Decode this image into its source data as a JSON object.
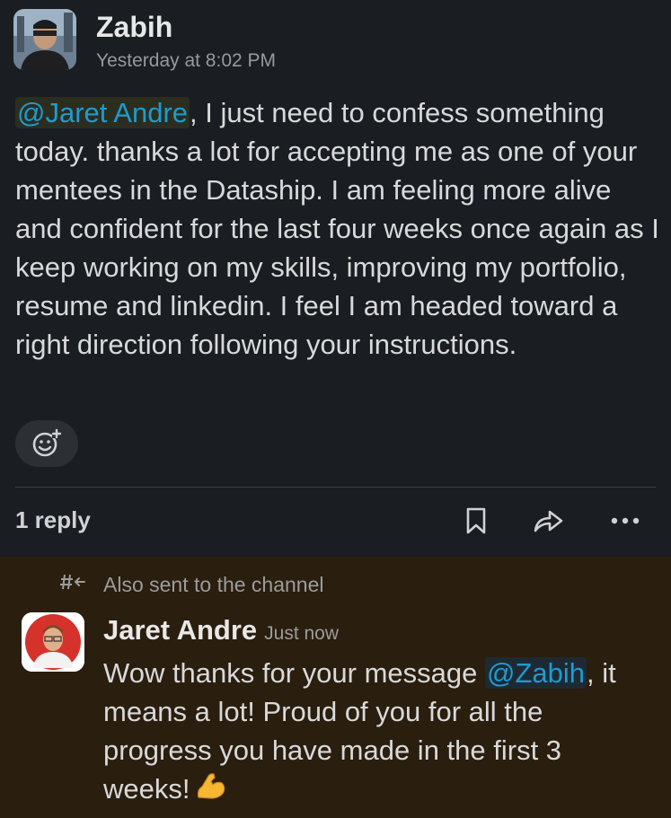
{
  "message1": {
    "author": "Zabih",
    "timestamp": "Yesterday at 8:02 PM",
    "mention": "@Jaret Andre",
    "text": ", I just need to confess something today. thanks a lot for accepting me as one of your mentees in the Dataship. I am feeling more alive and confident for the last four weeks once again as I keep working on my skills, improving my portfolio, resume and linkedin. I feel I am headed toward a right direction following your instructions.",
    "reply_count": "1 reply",
    "icons": [
      "add-reaction-icon",
      "bookmark-icon",
      "share-icon",
      "more-icon"
    ]
  },
  "message2": {
    "channel_note": "Also sent to the channel",
    "author": "Jaret Andre",
    "timestamp": "Just now",
    "text_before": "Wow thanks for your message ",
    "mention": "@Zabih",
    "text_after": ", it means a lot! Proud of you for all the progress you have made in the first 3 weeks!",
    "emoji": "flexed-biceps"
  },
  "colors": {
    "background": "#1a1d21",
    "thread_highlight": "#2a1e0e",
    "mention": "#1d9bd1"
  }
}
